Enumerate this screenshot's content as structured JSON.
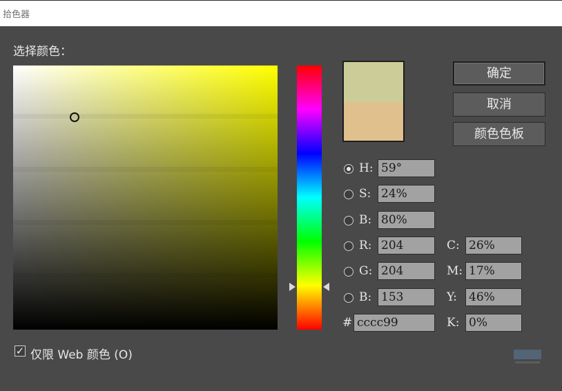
{
  "window": {
    "title": "拾色器"
  },
  "picker": {
    "prompt": "选择颜色："
  },
  "swatch": {
    "new_color": "#cccc99",
    "current_color": "#e0c08c"
  },
  "buttons": {
    "ok": "确定",
    "cancel": "取消",
    "swatches": "颜色色板"
  },
  "fields": {
    "h": {
      "label": "H:",
      "value": "59°"
    },
    "s": {
      "label": "S:",
      "value": "24%"
    },
    "b_hsb": {
      "label": "B:",
      "value": "80%"
    },
    "r": {
      "label": "R:",
      "value": "204"
    },
    "g": {
      "label": "G:",
      "value": "204"
    },
    "b_rgb": {
      "label": "B:",
      "value": "153"
    },
    "hex": {
      "label": "#",
      "value": "cccc99"
    },
    "c": {
      "label": "C:",
      "value": "26%"
    },
    "m": {
      "label": "M:",
      "value": "17%"
    },
    "y": {
      "label": "Y:",
      "value": "46%"
    },
    "k": {
      "label": "K:",
      "value": "0%"
    }
  },
  "web_only": {
    "checked": true,
    "label": "仅限 Web 颜色 (O)"
  },
  "colors": {
    "hue_top": "#ff0000",
    "field_corner": "#ffff00"
  }
}
